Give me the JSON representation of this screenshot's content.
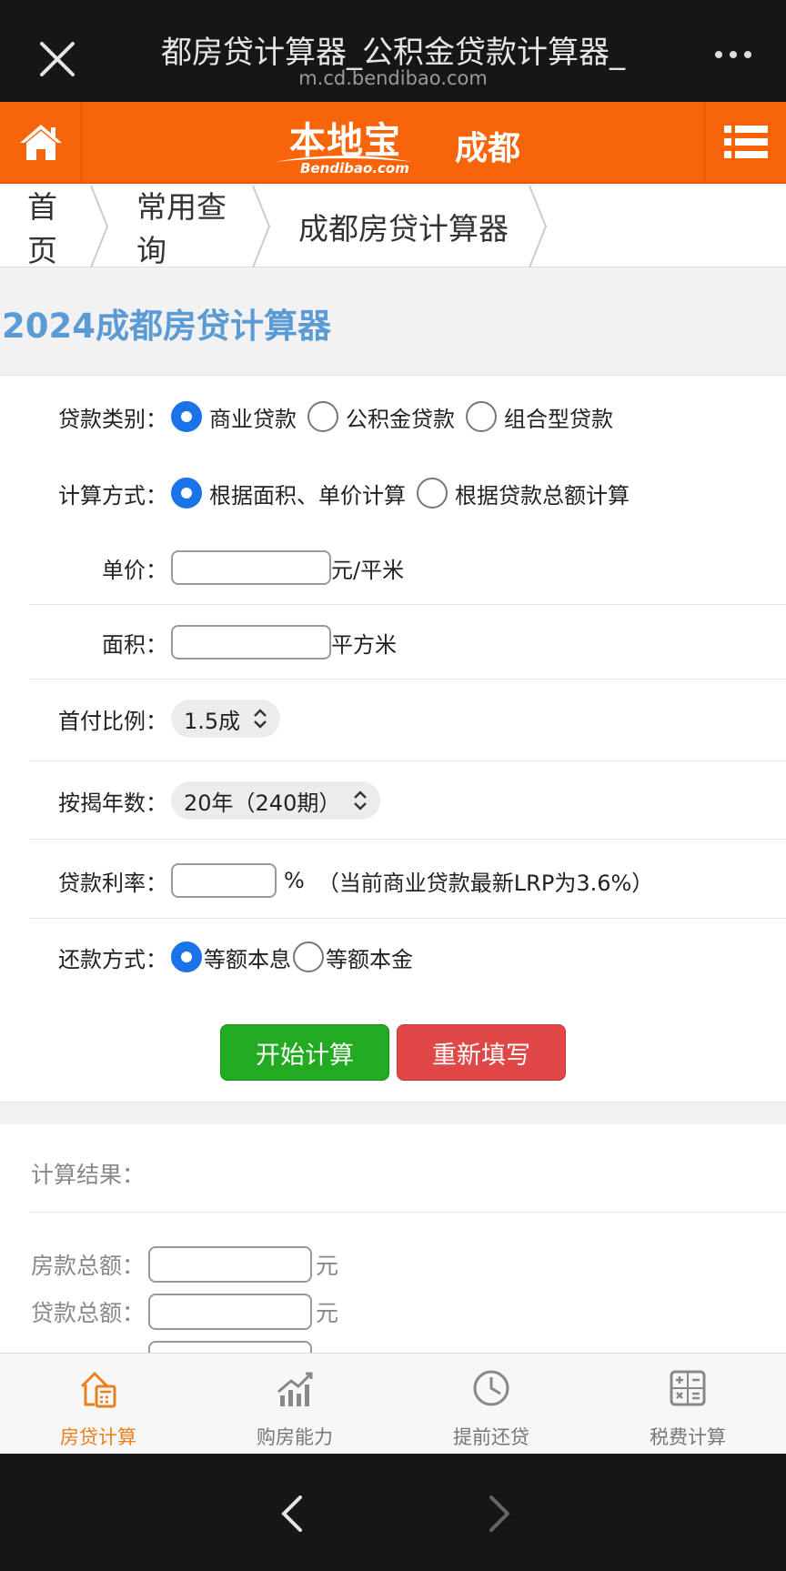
{
  "browser": {
    "title": "都房贷计算器_公积金贷款计算器_",
    "url": "m.cd.bendibao.com"
  },
  "header": {
    "logo_main": "本地宝",
    "logo_sub": "Bendibao.com",
    "city": "成都"
  },
  "breadcrumb": [
    "首页",
    "常用查询",
    "成都房贷计算器"
  ],
  "page_title": "2024成都房贷计算器",
  "form": {
    "loan_type": {
      "label": "贷款类别：",
      "options": [
        "商业贷款",
        "公积金贷款",
        "组合型贷款"
      ],
      "selected": 0
    },
    "calc_method": {
      "label": "计算方式：",
      "options": [
        "根据面积、单价计算",
        "根据贷款总额计算"
      ],
      "selected": 0
    },
    "unit_price": {
      "label": "单价：",
      "value": "",
      "unit": "元/平米"
    },
    "area": {
      "label": "面积：",
      "value": "",
      "unit": "平方米"
    },
    "down_payment": {
      "label": "首付比例：",
      "value": "1.5成"
    },
    "years": {
      "label": "按揭年数：",
      "value": "20年（240期）"
    },
    "rate": {
      "label": "贷款利率：",
      "value": "",
      "unit": "%",
      "note": "（当前商业贷款最新LRP为3.6%）"
    },
    "repayment": {
      "label": "还款方式：",
      "options": [
        "等额本息",
        "等额本金"
      ],
      "selected": 0
    },
    "calc_button": "开始计算",
    "reset_button": "重新填写"
  },
  "results": {
    "heading": "计算结果：",
    "rows": [
      {
        "label": "房款总额：",
        "unit": "元"
      },
      {
        "label": "贷款总额：",
        "unit": "元"
      }
    ]
  },
  "tabs": [
    {
      "label": "房贷计算",
      "icon": "house-calculator-icon",
      "active": true
    },
    {
      "label": "购房能力",
      "icon": "bar-chart-icon",
      "active": false
    },
    {
      "label": "提前还贷",
      "icon": "clock-icon",
      "active": false
    },
    {
      "label": "税费计算",
      "icon": "calculator-icon",
      "active": false
    }
  ],
  "colors": {
    "brand_orange": "#f7640a",
    "title_blue": "#5b9bd5",
    "radio_blue": "#1a73e8",
    "calc_green": "#22aa22",
    "reset_red": "#e04848",
    "tab_active": "#e8801f"
  }
}
